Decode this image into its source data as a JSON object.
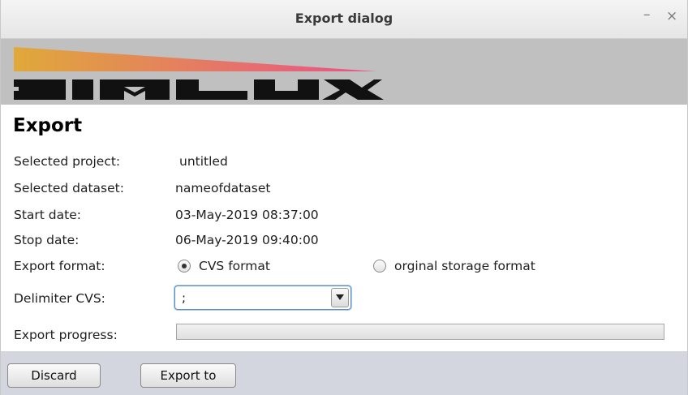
{
  "window": {
    "title": "Export dialog",
    "minimize_label": "–",
    "close_label": "×"
  },
  "banner": {
    "logo_text": "DIMLUX",
    "logo_colors": {
      "gradient_start": "#e0a93a",
      "gradient_end": "#e8508a",
      "letters": "#111111"
    }
  },
  "heading": "Export",
  "fields": {
    "project": {
      "label": "Selected project:",
      "value": "untitled"
    },
    "dataset": {
      "label": "Selected dataset:",
      "value": "nameofdataset"
    },
    "start": {
      "label": "Start date:",
      "value": "03-May-2019 08:37:00"
    },
    "stop": {
      "label": "Stop date:",
      "value": "06-May-2019 09:40:00"
    }
  },
  "export_format": {
    "label": "Export format:",
    "options": [
      {
        "label": "CVS format",
        "selected": true
      },
      {
        "label": "orginal storage format",
        "selected": false
      }
    ]
  },
  "delimiter": {
    "label": "Delimiter CVS:",
    "selected_value": ";"
  },
  "progress": {
    "label": "Export progress:",
    "value_percent": 0
  },
  "buttons": {
    "discard": "Discard",
    "export": "Export to"
  },
  "colors": {
    "footer_bg": "#d3d6de",
    "banner_bg": "#c0c0c0",
    "focus_border": "#5b8fc7"
  }
}
